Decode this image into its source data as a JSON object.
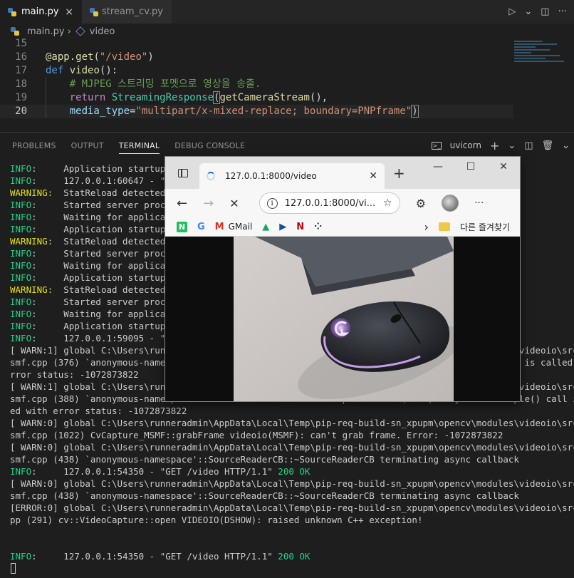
{
  "editor": {
    "tabs": [
      {
        "label": "main.py",
        "close": "×",
        "active": true
      },
      {
        "label": "stream_cv.py",
        "active": false
      }
    ],
    "actions": [
      "▷",
      "⌄",
      "◫",
      "···"
    ],
    "breadcrumb": {
      "file": "main.py",
      "sep": "›",
      "symbol": "video"
    },
    "code_lines": [
      {
        "num": "15",
        "html": ""
      },
      {
        "num": "16",
        "html": "<span class=\"dec\">@app.get</span>(<span class=\"str\">\"/video\"</span>)"
      },
      {
        "num": "17",
        "html": "<span class=\"kw\">def</span> <span class=\"fn\">video</span>():"
      },
      {
        "num": "18",
        "html": "    <span class=\"cmt\"># MJPEG 스트리밍 포멧으로 영상을 송출.</span>"
      },
      {
        "num": "19",
        "html": "    <span class=\"kw2\">return</span> <span class=\"cls\">StreamingResponse</span><span class=\"brbox\">(</span><span class=\"fn\">getCameraStream</span>(),"
      },
      {
        "num": "20",
        "html": "    <span class=\"prm\">media_type</span>=<span class=\"str\">\"multipart/x-mixed-replace; boundary=PNPframe\"</span><span class=\"brbox\">)</span>"
      }
    ]
  },
  "panel": {
    "tabs": [
      {
        "label": "PROBLEMS",
        "active": false
      },
      {
        "label": "OUTPUT",
        "active": false
      },
      {
        "label": "TERMINAL",
        "active": true
      },
      {
        "label": "DEBUG CONSOLE",
        "active": false
      }
    ],
    "terminal_name": "uvicorn",
    "actions": [
      "+",
      "⌄",
      "◫",
      "🗑",
      "⌄"
    ]
  },
  "terminal_lines": [
    "<span class=\"info\">INFO</span>:     Application startup c",
    "<span class=\"info\">INFO</span>:     127.0.0.1:60647 - \"GE",
    "<span class=\"warn\">WARNING</span>:  StatReload detected f",
    "<span class=\"info\">INFO</span>:     Started server proces",
    "<span class=\"info\">INFO</span>:     Waiting for applicati",
    "<span class=\"info\">INFO</span>:     Application startup c",
    "<span class=\"warn\">WARNING</span>:  StatReload detected f",
    "<span class=\"info\">INFO</span>:     Started server proces",
    "<span class=\"info\">INFO</span>:     Waiting for applicati",
    "<span class=\"info\">INFO</span>:     Application startup c",
    "<span class=\"warn\">WARNING</span>:  StatReload detected f",
    "<span class=\"info\">INFO</span>:     Started server proces",
    "<span class=\"info\">INFO</span>:     Waiting for applicati",
    "<span class=\"info\">INFO</span>:     Application startup c",
    "<span class=\"info\">INFO</span>:     127.0.0.1:59095 - \"GE",
    "[ WARN:1] global C:\\Users\\runneradmin\\AppData\\Local\\Temp\\pip-req-build-sn_xpupm\\opencv\\modules\\videoio\\src\\cap_m",
    "smf.cpp (376) `anonymous-namespace'::SourceReaderCB::OnReadSample videoio(MSMF): OnReadSample() is called with e",
    "rror status: -1072873822",
    "[ WARN:1] global C:\\Users\\runneradmin\\AppData\\Local\\Temp\\pip-req-build-sn_xpupm\\opencv\\modules\\videoio\\src\\cap_m",
    "smf.cpp (388) `anonymous-namespace'::SourceReaderCB::OnReadSample videoio(MSMF): async ReadSample() call is fail",
    "ed with error status: -1072873822",
    "[ WARN:0] global C:\\Users\\runneradmin\\AppData\\Local\\Temp\\pip-req-build-sn_xpupm\\opencv\\modules\\videoio\\src\\cap_m",
    "smf.cpp (1022) CvCapture_MSMF::grabFrame videoio(MSMF): can't grab frame. Error: -1072873822",
    "[ WARN:0] global C:\\Users\\runneradmin\\AppData\\Local\\Temp\\pip-req-build-sn_xpupm\\opencv\\modules\\videoio\\src\\cap_m",
    "smf.cpp (438) `anonymous-namespace'::SourceReaderCB::~SourceReaderCB terminating async callback",
    "<span class=\"info\">INFO</span>:     127.0.0.1:54350 - \"GET /video HTTP/1.1\" <span class=\"ok\">200 OK</span>",
    "[ WARN:0] global C:\\Users\\runneradmin\\AppData\\Local\\Temp\\pip-req-build-sn_xpupm\\opencv\\modules\\videoio\\src\\cap_m",
    "smf.cpp (438) `anonymous-namespace'::SourceReaderCB::~SourceReaderCB terminating async callback",
    "[ERROR:0] global C:\\Users\\runneradmin\\AppData\\Local\\Temp\\pip-req-build-sn_xpupm\\opencv\\modules\\videoio\\src\\cap.c",
    "pp (291) cv::VideoCapture::open VIDEOIO(DSHOW): raised unknown C++ exception!",
    "",
    "",
    "<span class=\"info\">INFO</span>:     127.0.0.1:54350 - \"GET /video HTTP/1.1\" <span class=\"ok\">200 OK</span>"
  ],
  "browser": {
    "tab_title": "127.0.0.1:8000/video",
    "tab_close": "✕",
    "new_tab": "+",
    "win_min": "—",
    "win_max": "☐",
    "win_close": "✕",
    "nav_back": "←",
    "nav_forward": "→",
    "nav_stop": "✕",
    "address": "127.0.0.1:8000/vi...",
    "more": "···",
    "favorites": [
      {
        "icon": "N",
        "label": ""
      },
      {
        "icon": "G",
        "label": ""
      },
      {
        "icon": "M",
        "label": "GMail"
      },
      {
        "icon": "▲",
        "label": ""
      },
      {
        "icon": "▶",
        "label": ""
      },
      {
        "icon": "N",
        "label": ""
      },
      {
        "icon": "⁘",
        "label": ""
      }
    ],
    "fav_chevron": "›",
    "fav_folder": "다른 즐겨찾기"
  },
  "colors": {
    "info": "#23d18b",
    "warning": "#e5e510",
    "editor_bg": "#1e1e1e",
    "mouse_glow": "#c77dff"
  }
}
